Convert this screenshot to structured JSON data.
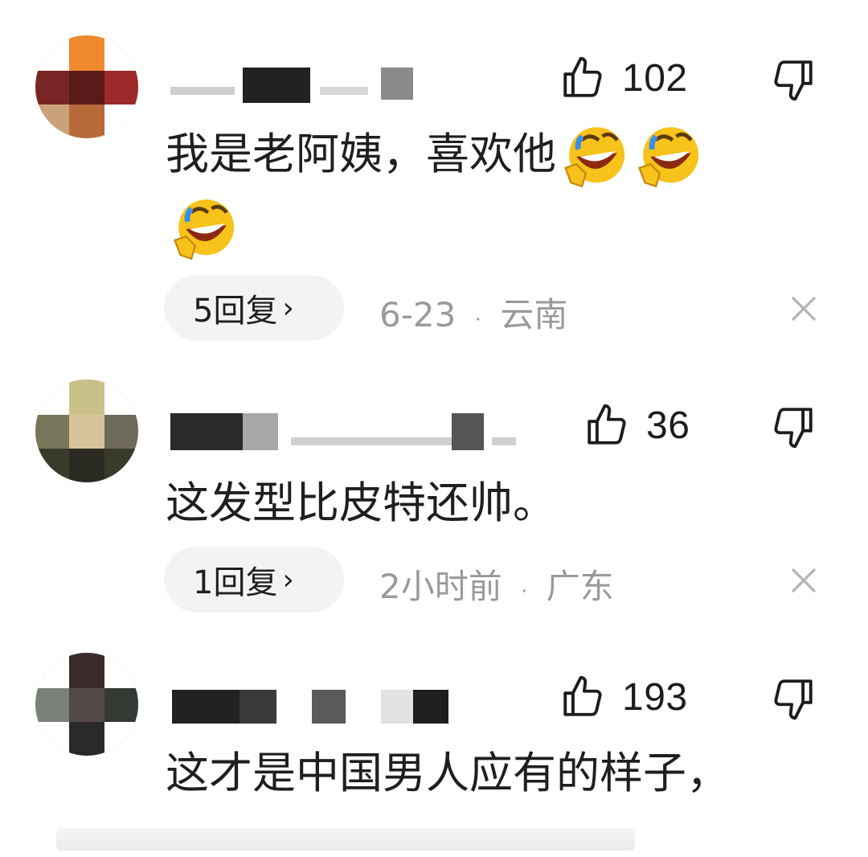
{
  "comments": [
    {
      "like_count": "102",
      "text": "我是老阿姨，喜欢他",
      "emoji": "rolling-on-floor-laughing",
      "reply_label": "5回复",
      "reply_chevron": "›",
      "time": "6-23",
      "separator": "·",
      "location": "云南"
    },
    {
      "like_count": "36",
      "text": "这发型比皮特还帅。",
      "reply_label": "1回复",
      "reply_chevron": "›",
      "time": "2小时前",
      "separator": "·",
      "location": "广东"
    },
    {
      "like_count": "193",
      "text": "这才是中国男人应有的样子，"
    }
  ],
  "colors": {
    "text": "#1f1f1f",
    "meta": "#9a9a9a",
    "pill": "#f3f3f3",
    "emoji_face": "#f7c21a"
  }
}
